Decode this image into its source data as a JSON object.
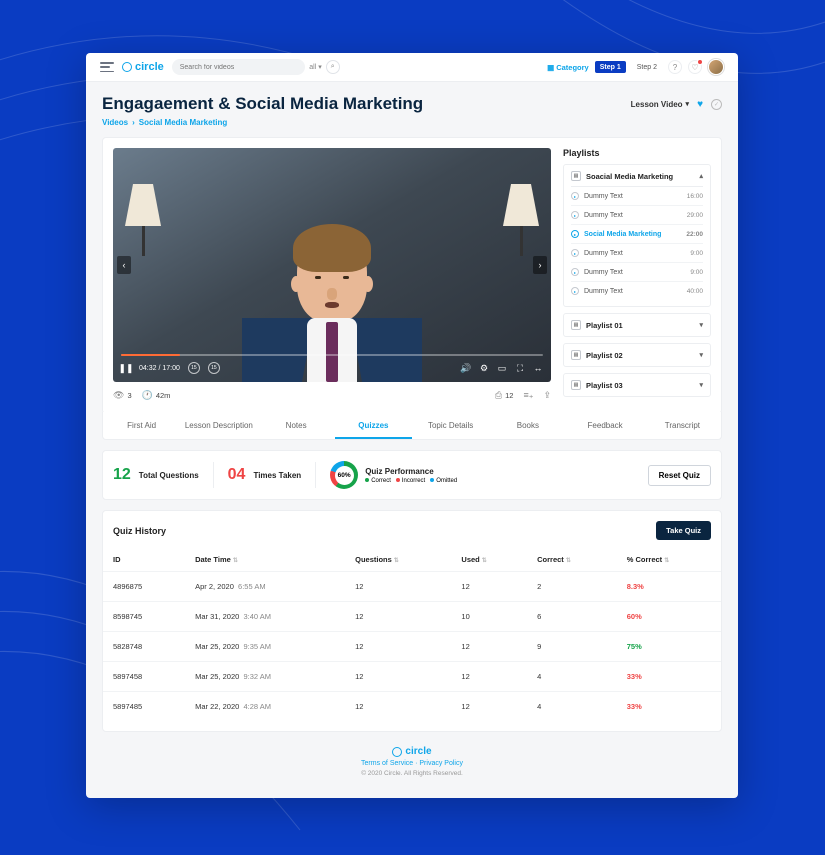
{
  "brand": "circle",
  "search": {
    "placeholder": "Search for videos"
  },
  "header": {
    "category": "Category",
    "step1": "Step 1",
    "step2": "Step 2"
  },
  "page": {
    "title": "Engagaement & Social Media Marketing",
    "breadcrumb": {
      "root": "Videos",
      "current": "Social Media Marketing"
    },
    "dropdown": "Lesson Video"
  },
  "video": {
    "current_time": "04:32",
    "total_time": "17:00",
    "time_display": "04:32 / 17:00",
    "seek_back": "15",
    "seek_fwd": "15",
    "views": "3",
    "duration": "42m",
    "pin_count": "12"
  },
  "playlist": {
    "title": "Playlists",
    "expanded": {
      "name": "Soacial Media Marketing",
      "items": [
        {
          "label": "Dummy Text",
          "dur": "16:00",
          "active": false
        },
        {
          "label": "Dummy Text",
          "dur": "29:00",
          "active": false
        },
        {
          "label": "Social Media Marketing",
          "dur": "22:00",
          "active": true
        },
        {
          "label": "Dummy Text",
          "dur": "9:00",
          "active": false
        },
        {
          "label": "Dummy Text",
          "dur": "9:00",
          "active": false
        },
        {
          "label": "Dummy Text",
          "dur": "40:00",
          "active": false
        }
      ]
    },
    "collapsed": [
      "Playlist 01",
      "Playlist 02",
      "Playlist 03"
    ]
  },
  "tabs": [
    "First Aid",
    "Lesson Description",
    "Notes",
    "Quizzes",
    "Topic Details",
    "Books",
    "Feedback",
    "Transcript"
  ],
  "active_tab": "Quizzes",
  "quiz_stats": {
    "total_questions": "12",
    "total_questions_label": "Total Questions",
    "times_taken": "04",
    "times_taken_label": "Times Taken",
    "performance": "60%",
    "performance_label": "Quiz Performance",
    "legend": {
      "correct": "Correct",
      "incorrect": "Incorrect",
      "omitted": "Omitted"
    },
    "reset": "Reset Quiz"
  },
  "history": {
    "title": "Quiz History",
    "take": "Take Quiz",
    "columns": {
      "id": "ID",
      "dt": "Date Time",
      "q": "Questions",
      "u": "Used",
      "c": "Correct",
      "pc": "% Correct"
    },
    "rows": [
      {
        "id": "4896875",
        "date": "Apr 2, 2020",
        "time": "6:55 AM",
        "q": "12",
        "u": "12",
        "c": "2",
        "pc": "8.3%",
        "pclass": "pct-low"
      },
      {
        "id": "8598745",
        "date": "Mar 31, 2020",
        "time": "3:40 AM",
        "q": "12",
        "u": "10",
        "c": "6",
        "pc": "60%",
        "pclass": "pct-low"
      },
      {
        "id": "5828748",
        "date": "Mar 25, 2020",
        "time": "9:35 AM",
        "q": "12",
        "u": "12",
        "c": "9",
        "pc": "75%",
        "pclass": "pct-high"
      },
      {
        "id": "5897458",
        "date": "Mar 25, 2020",
        "time": "9:32 AM",
        "q": "12",
        "u": "12",
        "c": "4",
        "pc": "33%",
        "pclass": "pct-low"
      },
      {
        "id": "5897485",
        "date": "Mar 22, 2020",
        "time": "4:28 AM",
        "q": "12",
        "u": "12",
        "c": "4",
        "pc": "33%",
        "pclass": "pct-low"
      }
    ]
  },
  "footer": {
    "terms": "Terms of Service",
    "privacy": "Privacy Policy",
    "copyright": "© 2020 Circle. All Rights Reserved."
  }
}
